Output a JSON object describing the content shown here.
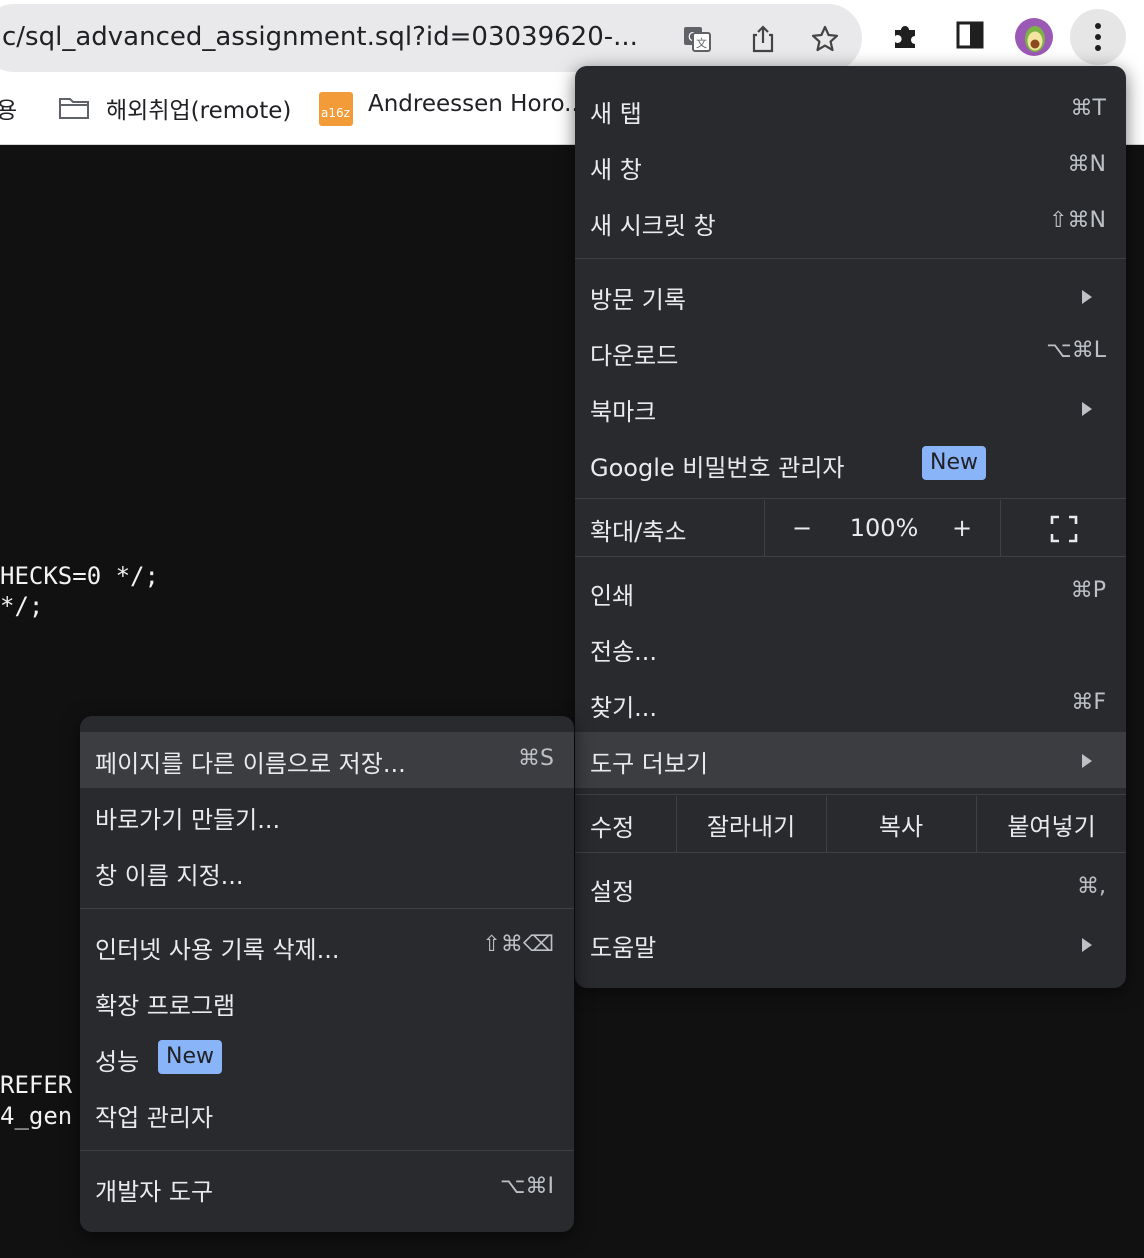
{
  "omnibox": {
    "url": "c/sql_advanced_assignment.sql?id=03039620-..."
  },
  "bookmarks": [
    {
      "label": "용"
    },
    {
      "label": "해외취업(remote)"
    },
    {
      "label": "Andreessen Horo..."
    }
  ],
  "bookmark_logo_text": "a16z",
  "code_lines": [
    "HECKS=0 */;",
    "*/;",
    "REFER",
    "4_gen"
  ],
  "main_menu": {
    "new_tab": {
      "label": "새 탭",
      "shortcut": "⌘T"
    },
    "new_window": {
      "label": "새 창",
      "shortcut": "⌘N"
    },
    "incognito": {
      "label": "새 시크릿 창",
      "shortcut": "⇧⌘N"
    },
    "history": {
      "label": "방문 기록"
    },
    "downloads": {
      "label": "다운로드",
      "shortcut": "⌥⌘L"
    },
    "bookmarks": {
      "label": "북마크"
    },
    "passwords": {
      "label": "Google 비밀번호 관리자",
      "badge": "New"
    },
    "zoom": {
      "label": "확대/축소",
      "minus": "−",
      "value": "100%",
      "plus": "+"
    },
    "print": {
      "label": "인쇄",
      "shortcut": "⌘P"
    },
    "cast": {
      "label": "전송..."
    },
    "find": {
      "label": "찾기...",
      "shortcut": "⌘F"
    },
    "more_tools": {
      "label": "도구 더보기"
    },
    "edit": {
      "label": "수정",
      "cut": "잘라내기",
      "copy": "복사",
      "paste": "붙여넣기"
    },
    "settings": {
      "label": "설정",
      "shortcut": "⌘,"
    },
    "help": {
      "label": "도움말"
    }
  },
  "sub_menu": {
    "save_as": {
      "label": "페이지를 다른 이름으로 저장...",
      "shortcut": "⌘S"
    },
    "shortcut": {
      "label": "바로가기 만들기..."
    },
    "name_window": {
      "label": "창 이름 지정..."
    },
    "clear_data": {
      "label": "인터넷 사용 기록 삭제...",
      "shortcut": "⇧⌘⌫"
    },
    "extensions": {
      "label": "확장 프로그램"
    },
    "performance": {
      "label": "성능",
      "badge": "New"
    },
    "task_manager": {
      "label": "작업 관리자"
    },
    "dev_tools": {
      "label": "개발자 도구",
      "shortcut": "⌥⌘I"
    }
  },
  "colors": {
    "menu_bg": "#292a2d",
    "highlight": "#3c3d41",
    "badge": "#8ab4f8",
    "page_bg": "#111111"
  }
}
